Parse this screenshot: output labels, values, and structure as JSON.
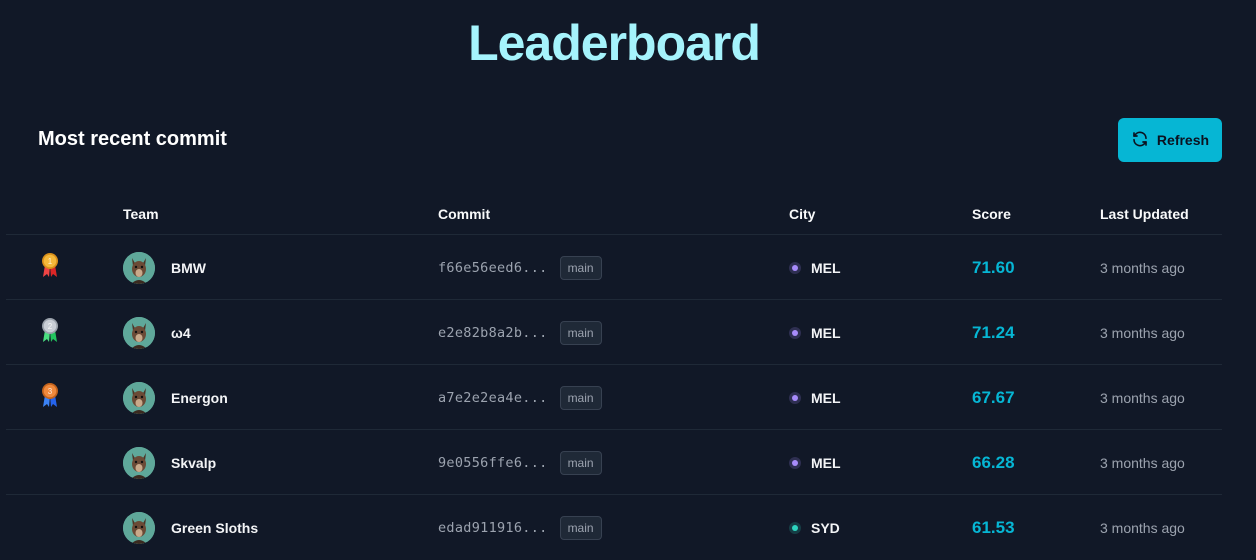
{
  "title": "Leaderboard",
  "section_title": "Most recent commit",
  "refresh_label": "Refresh",
  "columns": {
    "team": "Team",
    "commit": "Commit",
    "city": "City",
    "score": "Score",
    "updated": "Last Updated"
  },
  "colors": {
    "accent": "#06b6d4",
    "title": "#a5f3fc",
    "mel_dot": "#a78bfa",
    "syd_dot": "#2dd4bf"
  },
  "rows": [
    {
      "rank": "1",
      "medal": "gold-medal-icon",
      "team": "BMW",
      "commit": "f66e56eed6...",
      "branch": "main",
      "city": "MEL",
      "score": "71.60",
      "updated": "3 months ago"
    },
    {
      "rank": "2",
      "medal": "silver-medal-icon",
      "team": "ω4",
      "commit": "e2e82b8a2b...",
      "branch": "main",
      "city": "MEL",
      "score": "71.24",
      "updated": "3 months ago"
    },
    {
      "rank": "3",
      "medal": "bronze-medal-icon",
      "team": "Energon",
      "commit": "a7e2e2ea4e...",
      "branch": "main",
      "city": "MEL",
      "score": "67.67",
      "updated": "3 months ago"
    },
    {
      "rank": "",
      "medal": "",
      "team": "Skvalp",
      "commit": "9e0556ffe6...",
      "branch": "main",
      "city": "MEL",
      "score": "66.28",
      "updated": "3 months ago"
    },
    {
      "rank": "",
      "medal": "",
      "team": "Green Sloths",
      "commit": "edad911916...",
      "branch": "main",
      "city": "SYD",
      "score": "61.53",
      "updated": "3 months ago"
    }
  ]
}
